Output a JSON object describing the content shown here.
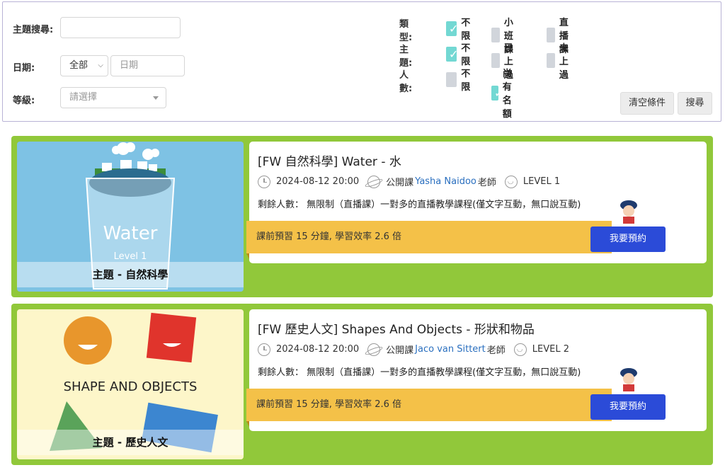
{
  "filters": {
    "topic_search_label": "主題搜尋:",
    "topic_search_value": "",
    "date_label": "日期:",
    "date_range_selected": "全部",
    "date_placeholder": "日期",
    "level_label": "等級:",
    "level_placeholder": "請選擇",
    "type_label": "類型:",
    "type_options": [
      {
        "label": "不限",
        "checked": true
      },
      {
        "label": "小班課",
        "checked": false
      },
      {
        "label": "直播課",
        "checked": false
      }
    ],
    "theme_label": "主題:",
    "theme_options": [
      {
        "label": "不限",
        "checked": true
      },
      {
        "label": "已上過",
        "checked": false
      },
      {
        "label": "未上過",
        "checked": false
      }
    ],
    "people_label": "人數:",
    "people_options": [
      {
        "label": "不限",
        "checked": false
      },
      {
        "label": "尚有名額",
        "checked": true
      }
    ],
    "clear_button": "清空條件",
    "search_button": "搜尋"
  },
  "courses": [
    {
      "thumb_caption": "主題 - 自然科學",
      "thumb_text": "Water",
      "thumb_sub": "Level 1",
      "title": "[FW 自然科學] Water - 水",
      "datetime": "2024-08-12 20:00",
      "class_type": "公開課",
      "teacher": "Yasha Naidoo",
      "teacher_suffix": "老師",
      "level": "LEVEL 1",
      "remaining": "剩餘人數：  無限制（直播課）一對多的直播教學課程(僅文字互動，無口說互動)",
      "banner": "課前預習 15 分鐘, 學習效率 2.6 倍",
      "book_button": "我要預約"
    },
    {
      "thumb_caption": "主題 - 歷史人文",
      "thumb_text": "SHAPE AND OBJECTS",
      "title": "[FW 歷史人文] Shapes And Objects - 形狀和物品",
      "datetime": "2024-08-12 20:00",
      "class_type": "公開課",
      "teacher": "Jaco van Sittert",
      "teacher_suffix": "老師",
      "level": "LEVEL 2",
      "remaining": "剩餘人數：  無限制（直播課）一對多的直播教學課程(僅文字互動，無口說互動)",
      "banner": "課前預習 15 分鐘, 學習效率 2.6 倍",
      "book_button": "我要預約"
    }
  ]
}
